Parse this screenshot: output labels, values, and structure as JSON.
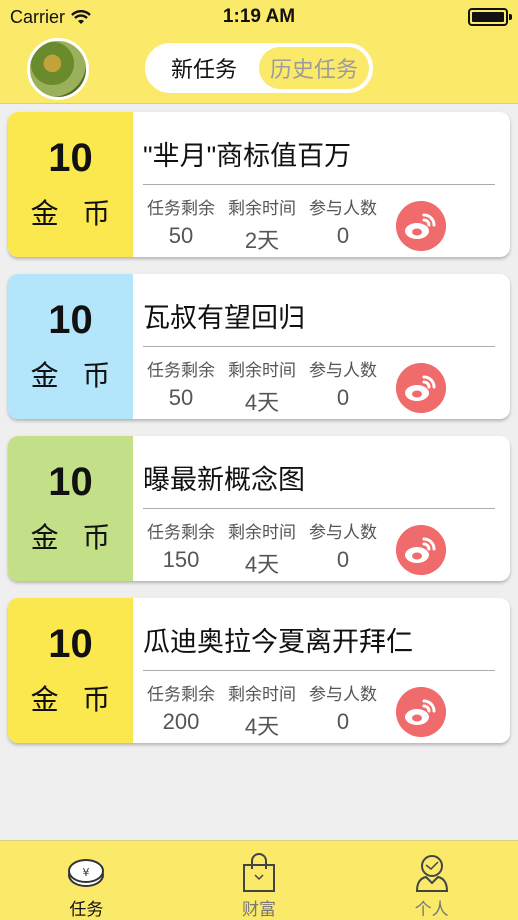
{
  "status_bar": {
    "carrier": "Carrier",
    "time": "1:19 AM"
  },
  "header": {
    "segments": [
      {
        "label": "新任务",
        "active": true
      },
      {
        "label": "历史任务",
        "active": false
      }
    ]
  },
  "tasks": [
    {
      "reward": "10",
      "unit": "金 币",
      "color": "#fbe84f",
      "title": "\"芈月\"商标值百万",
      "stats": [
        {
          "label": "任务剩余",
          "value": "50"
        },
        {
          "label": "剩余时间",
          "value": "2天"
        },
        {
          "label": "参与人数",
          "value": "0"
        }
      ]
    },
    {
      "reward": "10",
      "unit": "金 币",
      "color": "#b3e6fb",
      "title": "瓦叔有望回归",
      "stats": [
        {
          "label": "任务剩余",
          "value": "50"
        },
        {
          "label": "剩余时间",
          "value": "4天"
        },
        {
          "label": "参与人数",
          "value": "0"
        }
      ]
    },
    {
      "reward": "10",
      "unit": "金 币",
      "color": "#c3df88",
      "title": "曝最新概念图",
      "stats": [
        {
          "label": "任务剩余",
          "value": "150"
        },
        {
          "label": "剩余时间",
          "value": "4天"
        },
        {
          "label": "参与人数",
          "value": "0"
        }
      ]
    },
    {
      "reward": "10",
      "unit": "金 币",
      "color": "#fbe84f",
      "title": "瓜迪奥拉今夏离开拜仁",
      "stats": [
        {
          "label": "任务剩余",
          "value": "200"
        },
        {
          "label": "剩余时间",
          "value": "4天"
        },
        {
          "label": "参与人数",
          "value": "0"
        }
      ]
    }
  ],
  "tabbar": {
    "tabs": [
      {
        "label": "任务",
        "icon": "coin-icon",
        "active": true
      },
      {
        "label": "财富",
        "icon": "bag-icon",
        "active": false
      },
      {
        "label": "个人",
        "icon": "person-icon",
        "active": false
      }
    ]
  },
  "colors": {
    "brand_yellow": "#fbe96a",
    "weibo_red": "#f06b6b"
  }
}
